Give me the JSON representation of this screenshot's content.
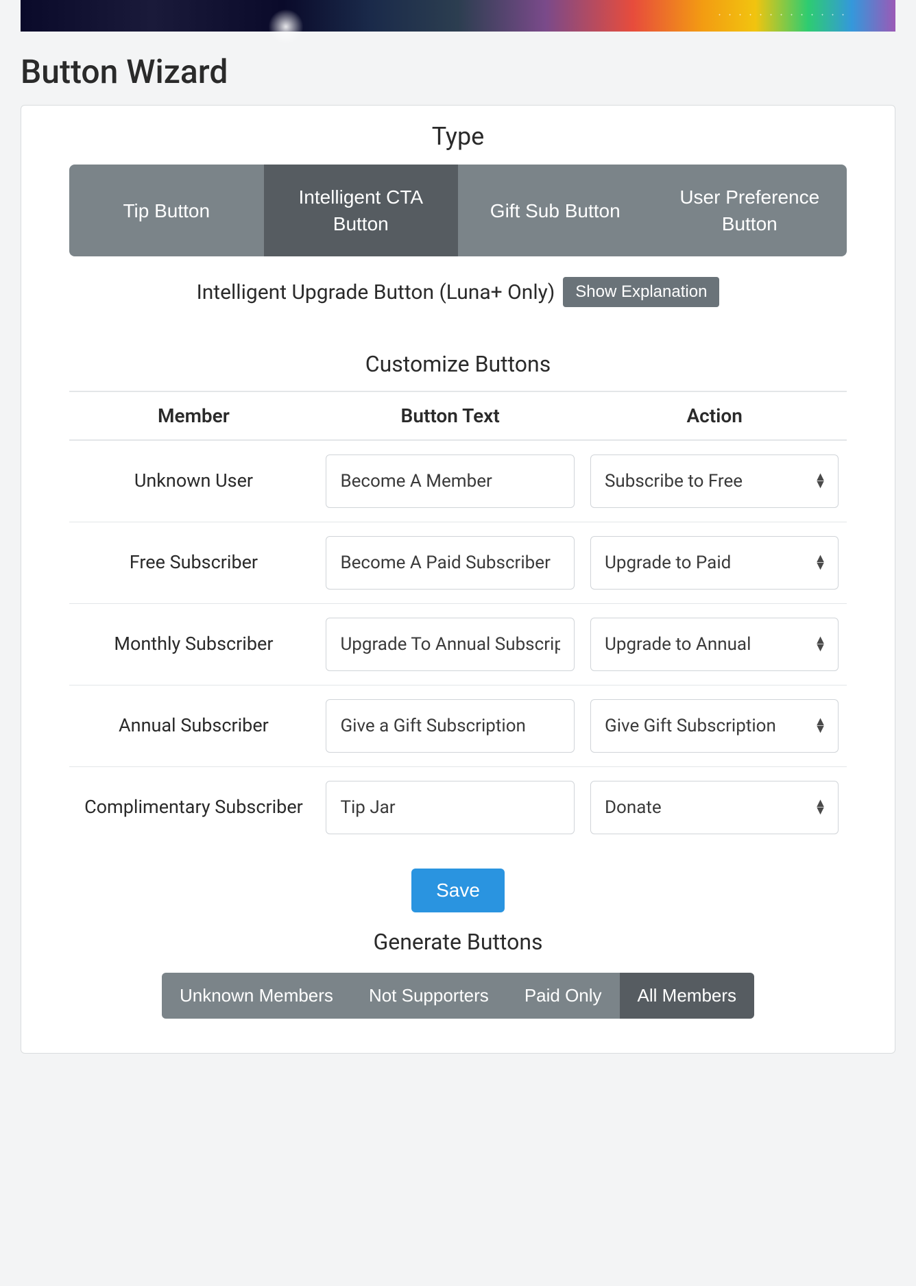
{
  "page_title": "Button Wizard",
  "type_section": {
    "heading": "Type",
    "tabs": [
      {
        "label": "Tip Button"
      },
      {
        "label": "Intelligent CTA Button"
      },
      {
        "label": "Gift Sub Button"
      },
      {
        "label": "User Preference Button"
      }
    ],
    "subheader": "Intelligent Upgrade Button (Luna+ Only)",
    "explain_button": "Show Explanation"
  },
  "customize": {
    "heading": "Customize Buttons",
    "columns": {
      "member": "Member",
      "button_text": "Button Text",
      "action": "Action"
    },
    "rows": [
      {
        "member": "Unknown User",
        "button_text": "Become A Member",
        "action": "Subscribe to Free"
      },
      {
        "member": "Free Subscriber",
        "button_text": "Become A Paid Subscriber",
        "action": "Upgrade to Paid"
      },
      {
        "member": "Monthly Subscriber",
        "button_text": "Upgrade To Annual Subscription",
        "action": "Upgrade to Annual"
      },
      {
        "member": "Annual Subscriber",
        "button_text": "Give a Gift Subscription",
        "action": "Give Gift Subscription"
      },
      {
        "member": "Complimentary Subscriber",
        "button_text": "Tip Jar",
        "action": "Donate"
      }
    ],
    "save_label": "Save"
  },
  "generate": {
    "heading": "Generate Buttons",
    "tabs": [
      {
        "label": "Unknown Members"
      },
      {
        "label": "Not Supporters"
      },
      {
        "label": "Paid Only"
      },
      {
        "label": "All Members"
      }
    ]
  }
}
